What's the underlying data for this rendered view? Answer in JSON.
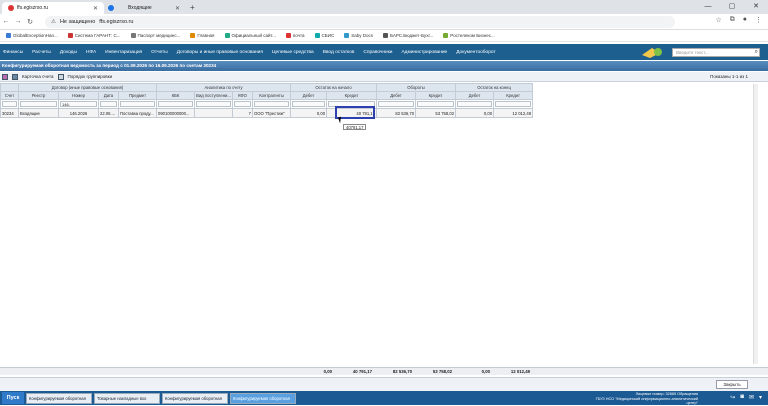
{
  "browser": {
    "tabs": [
      {
        "title": "ffs.egiszrso.ru",
        "active": true
      },
      {
        "title": "Входящие",
        "active": false
      }
    ],
    "security": "Не защищено",
    "url": "ffs.egiszrso.ru",
    "bookmarks": [
      "GlobalExceptionHan...",
      "Система ГАРАНТ: С...",
      "Паспорт медицинс...",
      "Главная",
      "Официальный сайт...",
      "почта",
      "СБИС",
      "Saby Docs",
      "БАРС.Бюджет-Бухг...",
      "Ростелеком Бизнес..."
    ]
  },
  "menu": {
    "items": [
      "Финансы",
      "Расчеты",
      "Доходы",
      "НФА",
      "Инвентаризация",
      "Отчеты",
      "Договоры и иные правовые основания",
      "Целевые средства",
      "Ввод остатков",
      "Справочники",
      "Администрирование",
      "Документооборот"
    ],
    "search_placeholder": "Введите текст..."
  },
  "window": {
    "title": "Конфигурируемая оборотная ведомость за период с 01.09.2026 по 16.09.2026 по счетам 30234"
  },
  "toolbar": {
    "card_label": "Карточка счета",
    "group_label": "Порядок группировки",
    "shown": "Показаны 1-1 из 1"
  },
  "grid": {
    "groups": {
      "contract": "Договор (иные правовые основания)",
      "analytics": "Аналитика по счету",
      "opening": "Остаток на начало",
      "turnover": "Обороты",
      "closing": "Остаток на конец"
    },
    "columns": {
      "account": "Счет",
      "registry": "Реестр",
      "number": "Номер",
      "date": "Дата",
      "subject": "Предмет",
      "kbk": "КБК",
      "income_type": "Вид поступлени...",
      "kfo": "КФО",
      "counterparty": "Контрагенты",
      "debit": "Дебет",
      "credit": "Кредит"
    },
    "filter_number": "146.",
    "row": {
      "account": "30234",
      "registry": "Входящие",
      "number": "146.2026",
      "date": "22.06....",
      "subject": "Поставка проду...",
      "kbk": "090100000000...",
      "income_type": "",
      "kfo": "7",
      "counterparty": "ООО \"Престиж\"",
      "open_debit": "0,00",
      "open_credit": "40 791,17",
      "turn_debit": "82 536,70",
      "turn_credit": "53 758,02",
      "close_debit": "0,00",
      "close_credit": "12 012,49"
    },
    "tooltip": "40791,17",
    "totals": {
      "open_debit": "0,00",
      "open_credit": "40 791,17",
      "turn_debit": "82 536,70",
      "turn_credit": "53 758,02",
      "close_debit": "0,00",
      "close_credit": "12 012,49"
    }
  },
  "bottom": {
    "close_label": "Закрыть"
  },
  "taskbar": {
    "start": "Пуск",
    "tasks": [
      "Конфигурируемая оборотная",
      "Товарные накладные вхо",
      "Конфигурируемая оборотная",
      "Конфигурируемая оборотная"
    ],
    "user_line1": "Лицевые номер: 32865 Обращения",
    "user_line2": "ГБУЗ НСО \"Медицинский информационно-аналитический центр\""
  }
}
